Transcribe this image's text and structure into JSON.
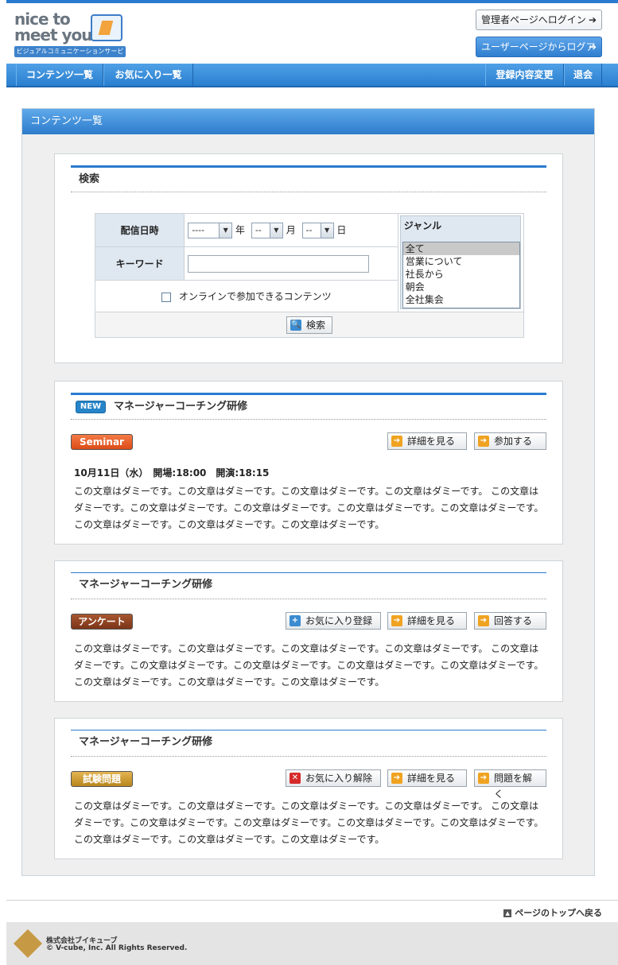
{
  "header": {
    "logo_line1": "nice to",
    "logo_line2": "meet you",
    "logo_tagline": "ビジュアルコミュニケーションサービス",
    "admin_login": "管理者ページへログイン",
    "user_logout": "ユーザーページからログアウト"
  },
  "nav": {
    "items": [
      "コンテンツ一覧",
      "お気に入り一覧",
      "登録内容変更",
      "退会"
    ]
  },
  "page_title": "コンテンツ一覧",
  "search": {
    "title": "検索",
    "date_label": "配信日時",
    "year_value": "----",
    "year_unit": "年",
    "month_value": "--",
    "month_unit": "月",
    "day_value": "--",
    "day_unit": "日",
    "keyword_label": "キーワード",
    "keyword_value": "",
    "genre_label": "ジャンル",
    "genres": [
      "全て",
      "営業について",
      "社長から",
      "朝会",
      "全社集会"
    ],
    "online_label": "オンラインで参加できるコンテンツ",
    "search_button": "検索"
  },
  "contents": [
    {
      "new": "NEW",
      "title": "マネージャーコーチング研修",
      "type": "Seminar",
      "buttons": [
        "詳細を見る",
        "参加する"
      ],
      "date_line": "10月11日（水）　開場:18:00　開演:18:15",
      "text": "この文章はダミーです。この文章はダミーです。この文章はダミーです。この文章はダミーです。 この文章はダミーです。この文章はダミーです。この文章はダミーです。この文章はダミーです。この文章はダミーです。この文章はダミーです。この文章はダミーです。この文章はダミーです。"
    },
    {
      "title": "マネージャーコーチング研修",
      "type": "アンケート",
      "buttons": [
        "お気に入り登録",
        "詳細を見る",
        "回答する"
      ],
      "text": "この文章はダミーです。この文章はダミーです。この文章はダミーです。この文章はダミーです。 この文章はダミーです。この文章はダミーです。この文章はダミーです。この文章はダミーです。この文章はダミーです。この文章はダミーです。この文章はダミーです。この文章はダミーです。"
    },
    {
      "title": "マネージャーコーチング研修",
      "type": "試験問題",
      "buttons": [
        "お気に入り解除",
        "詳細を見る",
        "問題を解く"
      ],
      "text": "この文章はダミーです。この文章はダミーです。この文章はダミーです。この文章はダミーです。 この文章はダミーです。この文章はダミーです。この文章はダミーです。この文章はダミーです。この文章はダミーです。この文章はダミーです。この文章はダミーです。この文章はダミーです。"
    }
  ],
  "footer": {
    "to_top": "ページのトップへ戻る",
    "company": "株式会社ブイキューブ",
    "copyright": "© V-cube, Inc. All Rights Reserved."
  },
  "colors": {
    "accent": "#2a7bd0",
    "seminar": "#e85a1f",
    "survey": "#8a3e1e",
    "exam": "#c89a2e"
  },
  "icons": [
    "search-icon",
    "arrow-right-icon",
    "plus-icon",
    "close-icon",
    "page-top-icon"
  ]
}
